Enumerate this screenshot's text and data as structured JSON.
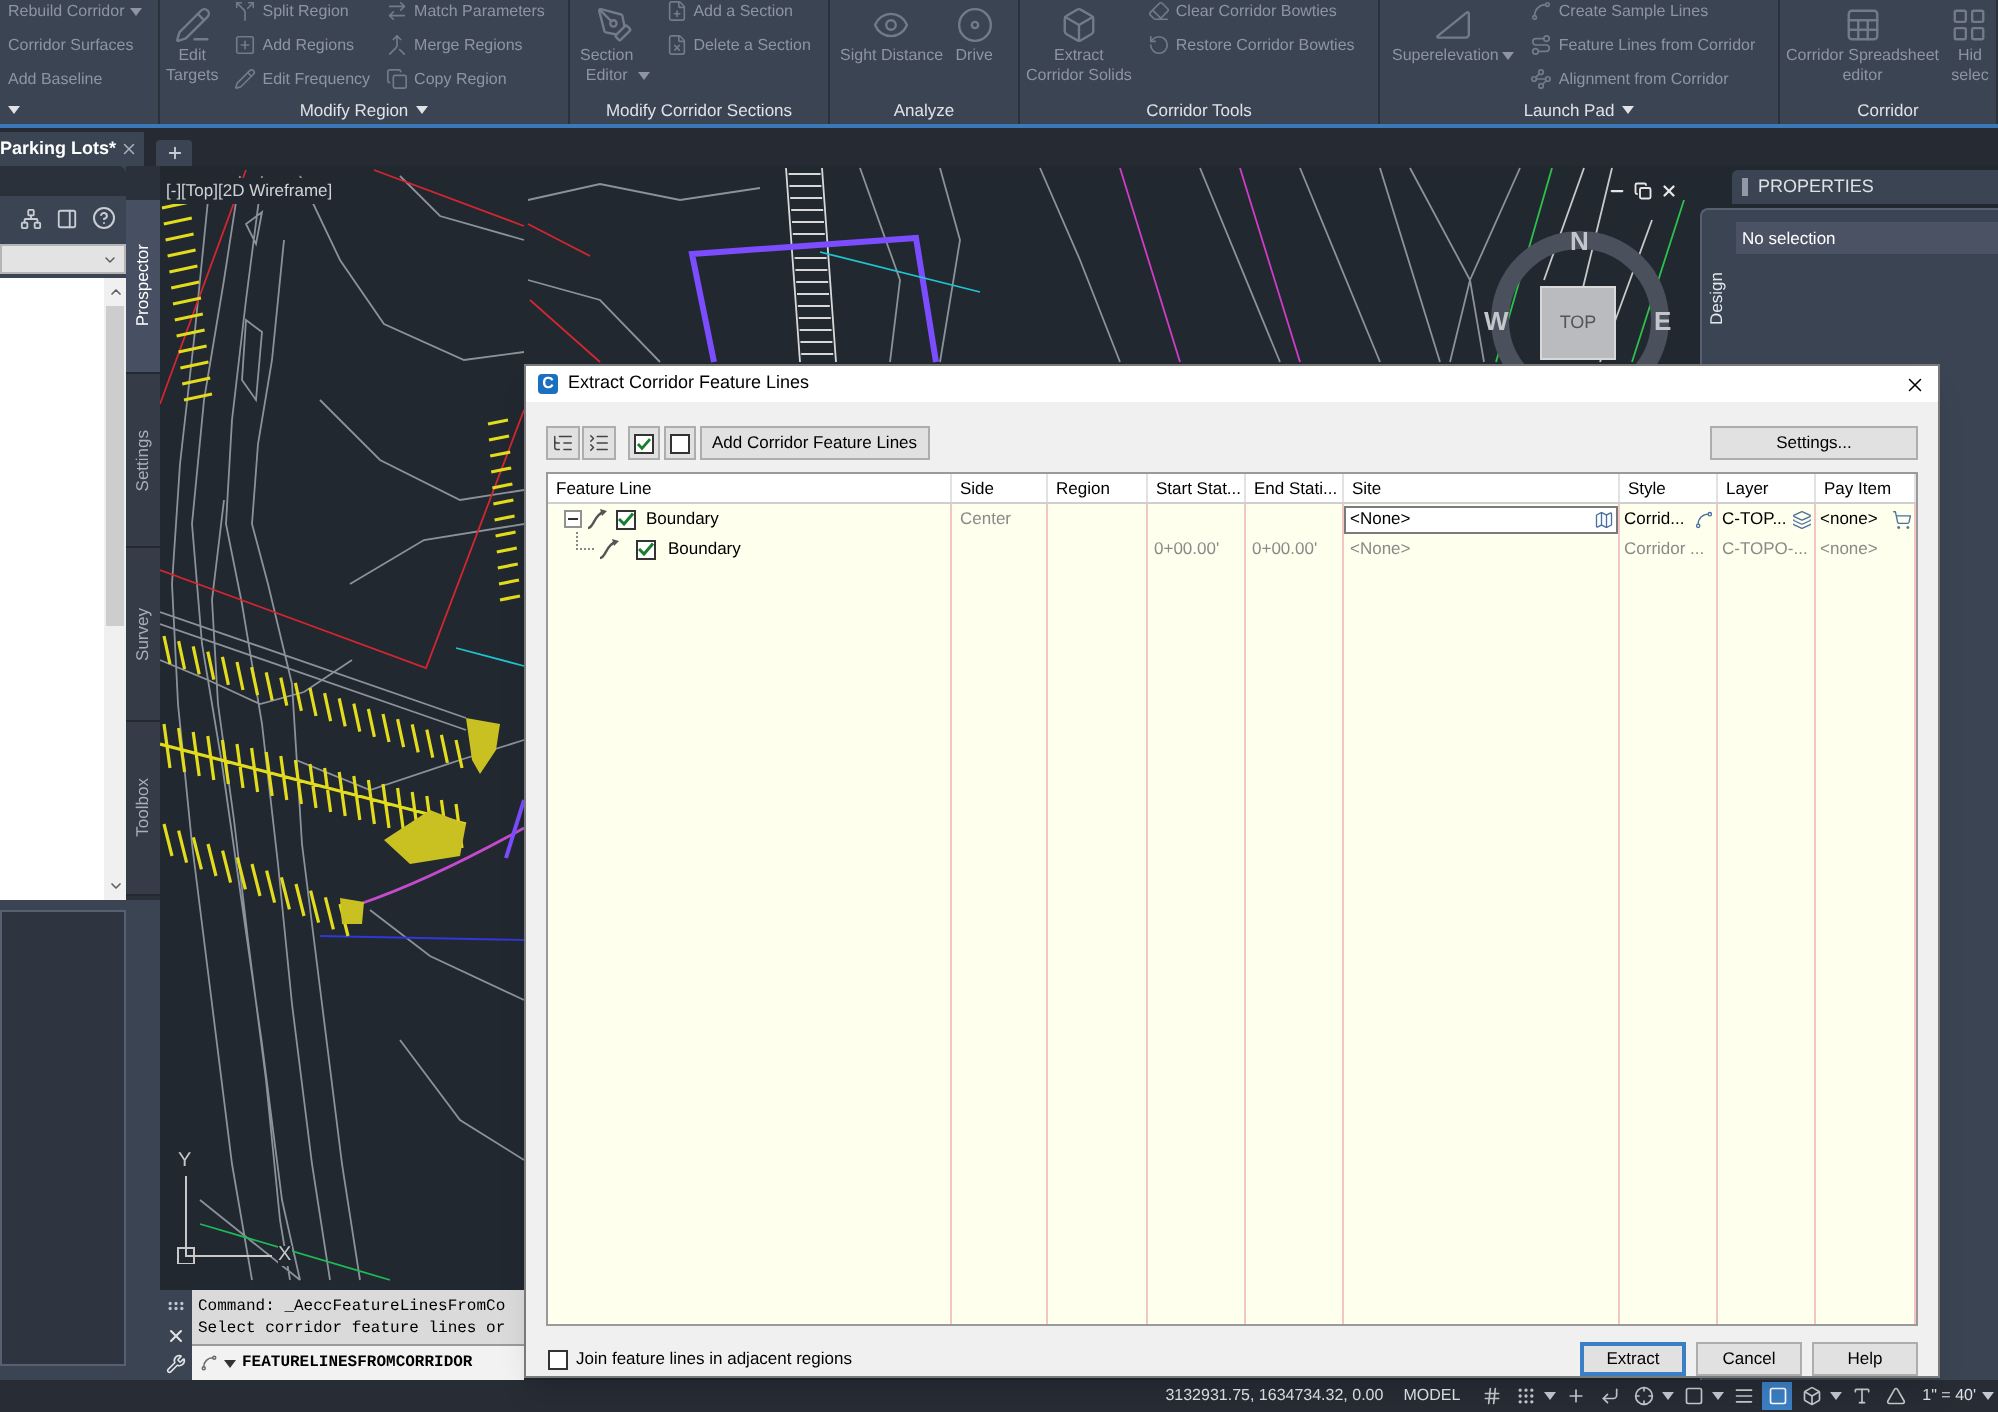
{
  "ribbon": {
    "panels": [
      {
        "menu": true,
        "groups": [
          {
            "kind": "labels",
            "items": [
              {
                "label": "Rebuild Corridor",
                "dropdown": true
              },
              {
                "label": "Corridor Surfaces"
              },
              {
                "label": "Add Baseline"
              }
            ]
          }
        ]
      },
      {
        "title": "Modify Region",
        "menu": true,
        "groups": [
          {
            "kind": "large",
            "items": [
              {
                "label": "Edit\nTargets"
              }
            ]
          },
          {
            "kind": "stack",
            "items": [
              {
                "label": "Split Region"
              },
              {
                "label": "Add Regions"
              },
              {
                "label": "Edit Frequency"
              }
            ]
          },
          {
            "kind": "stack",
            "items": [
              {
                "label": "Match Parameters"
              },
              {
                "label": "Merge Regions"
              },
              {
                "label": "Copy Region"
              }
            ]
          }
        ]
      },
      {
        "title": "Modify Corridor Sections",
        "menu": false,
        "groups": [
          {
            "kind": "large",
            "items": [
              {
                "label": "Section\nEditor",
                "dropdown": true
              }
            ]
          },
          {
            "kind": "stack",
            "items": [
              {
                "label": "Add a Section"
              },
              {
                "label": "Delete a Section"
              }
            ]
          }
        ]
      },
      {
        "title": "Analyze",
        "menu": false,
        "groups": [
          {
            "kind": "large",
            "items": [
              {
                "label": "Sight Distance"
              },
              {
                "label": "Drive"
              }
            ]
          }
        ]
      },
      {
        "title": "Corridor Tools",
        "menu": false,
        "groups": [
          {
            "kind": "large",
            "items": [
              {
                "label": "Extract\nCorridor Solids"
              }
            ]
          },
          {
            "kind": "stack",
            "items": [
              {
                "label": "Clear Corridor Bowties"
              },
              {
                "label": "Restore Corridor Bowties"
              }
            ]
          }
        ]
      },
      {
        "title": "Launch Pad",
        "menu": true,
        "groups": [
          {
            "kind": "large",
            "items": [
              {
                "label": "Superelevation",
                "dropdown": true
              }
            ]
          },
          {
            "kind": "stack",
            "items": [
              {
                "label": "Create Sample Lines"
              },
              {
                "label": "Feature Lines from Corridor"
              },
              {
                "label": "Alignment from Corridor"
              }
            ]
          }
        ]
      },
      {
        "title": "Corridor",
        "menu": false,
        "groups": [
          {
            "kind": "large",
            "items": [
              {
                "label": "Corridor Spreadsheet\neditor"
              },
              {
                "label": "Hid\nselec"
              }
            ]
          }
        ]
      }
    ]
  },
  "document_tabs": [
    {
      "label": "Parking Lots*",
      "selected": true
    }
  ],
  "toolspace": {
    "tabs": [
      {
        "label": "Prospector",
        "selected": true
      },
      {
        "label": "Settings",
        "selected": false
      },
      {
        "label": "Survey",
        "selected": false
      },
      {
        "label": "Toolbox",
        "selected": false
      }
    ]
  },
  "viewport": {
    "label": "[-][Top][2D Wireframe]",
    "viewcube": {
      "north": "N",
      "west": "W",
      "east": "E",
      "face": "TOP"
    },
    "ucs": {
      "x_label": "X",
      "y_label": "Y"
    }
  },
  "command_line": {
    "history": [
      "Command: _AeccFeatureLinesFromCo",
      "Select corridor feature lines or"
    ],
    "input": "FEATURELINESFROMCORRIDOR"
  },
  "properties": {
    "title": "PROPERTIES",
    "selection": "No selection",
    "tabs": [
      {
        "label": "Design",
        "selected": true
      }
    ]
  },
  "dialog": {
    "icon_letter": "C",
    "title": "Extract Corridor Feature Lines",
    "add_button": "Add Corridor Feature Lines",
    "settings_button": "Settings...",
    "columns": [
      "Feature Line",
      "Side",
      "Region",
      "Start Stat...",
      "End Stati...",
      "Site",
      "Style",
      "Layer",
      "Pay Item"
    ],
    "feature_lines": [
      {
        "name": "Boundary",
        "checked": true,
        "expanded": true,
        "selected": true,
        "side": "Center",
        "site": "<None>",
        "style": "Corrid...",
        "layer": "C-TOP...",
        "pay_item": "<none>",
        "children": [
          {
            "name": "Boundary",
            "checked": true,
            "selected": false,
            "start_station": "0+00.00'",
            "end_station": "0+00.00'",
            "site": "<None>",
            "style": "Corridor ...",
            "layer": "C-TOPO-...",
            "pay_item": "<none>"
          }
        ]
      }
    ],
    "join_option": {
      "label": "Join feature lines in adjacent regions",
      "checked": false
    },
    "buttons": [
      {
        "label": "Extract",
        "default": true
      },
      {
        "label": "Cancel",
        "default": false
      },
      {
        "label": "Help",
        "default": false
      }
    ]
  },
  "status_bar": {
    "coordinates": "3132931.75, 1634734.32, 0.00",
    "space": "MODEL",
    "toggles": [
      {
        "on": false
      },
      {
        "on": false
      },
      {
        "on": false
      },
      {
        "on": false
      },
      {
        "on": false
      },
      {
        "on": false
      },
      {
        "on": false
      },
      {
        "on": true
      },
      {
        "on": false
      },
      {
        "on": false
      },
      {
        "on": false
      }
    ],
    "scale": "1\" = 40'"
  }
}
